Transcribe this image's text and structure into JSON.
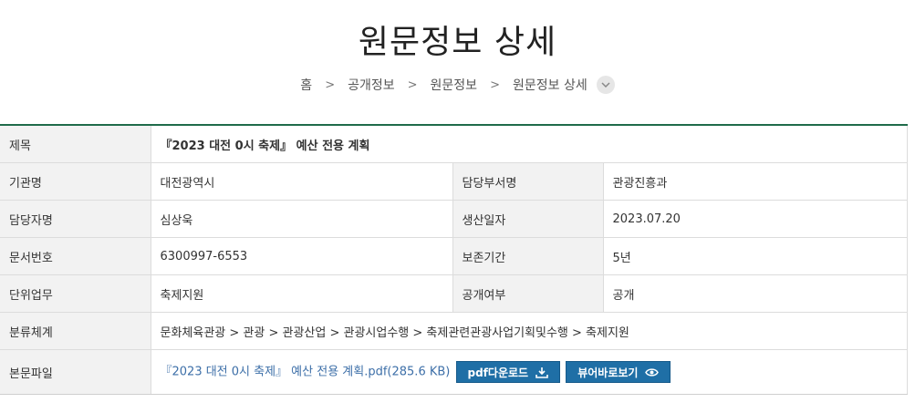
{
  "header": {
    "title": "원문정보 상세"
  },
  "breadcrumb": {
    "home": "홈",
    "items": [
      "공개정보",
      "원문정보",
      "원문정보 상세"
    ]
  },
  "detail": {
    "title_label": "제목",
    "title_value": "『2023 대전 0시 축제』 예산 전용 계획",
    "org_label": "기관명",
    "org_value": "대전광역시",
    "dept_label": "담당부서명",
    "dept_value": "관광진흥과",
    "manager_label": "담당자명",
    "manager_value": "심상욱",
    "date_label": "생산일자",
    "date_value": "2023.07.20",
    "docno_label": "문서번호",
    "docno_value": "6300997-6553",
    "retention_label": "보존기간",
    "retention_value": "5년",
    "task_label": "단위업무",
    "task_value": "축제지원",
    "public_label": "공개여부",
    "public_value": "공개",
    "category_label": "분류체계",
    "category_value": "문화체육관광 > 관광 > 관광산업 > 관광시업수행 > 축제관련관광사업기획및수행 > 축제지원",
    "file_label": "본문파일",
    "file_name": "『2023 대전 0시 축제』 예산 전용 계획.pdf(285.6 KB)",
    "download_label": "pdf다운로드",
    "viewer_label": "뷰어바로보기"
  },
  "colors": {
    "accent_line": "#1f6b4a",
    "button_bg": "#1f6fa6",
    "link": "#1a4f8b",
    "header_cell_bg": "#f2f2f2"
  },
  "icons": [
    "chevron-down-icon",
    "download-icon",
    "eye-icon"
  ]
}
